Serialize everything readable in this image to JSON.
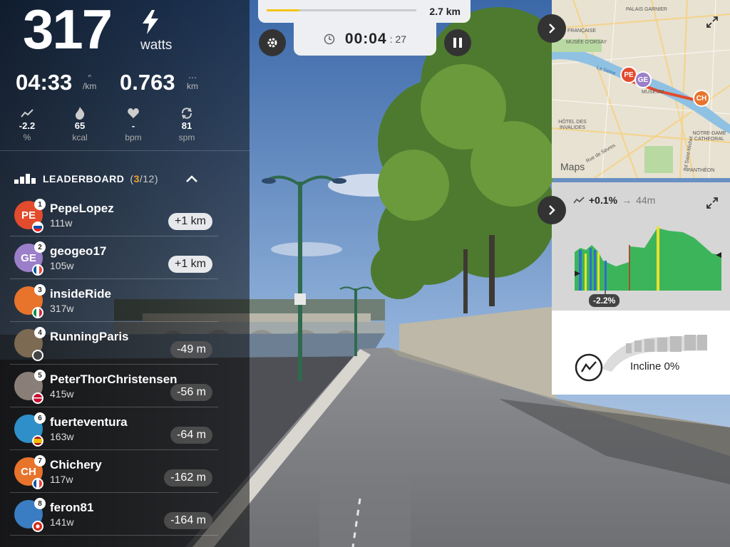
{
  "metrics": {
    "power": "317",
    "power_unit": "watts",
    "pace": "04:33",
    "pace_unit": "/km",
    "distance": "0.763",
    "distance_unit": "km",
    "stats": [
      {
        "icon": "incline-icon",
        "value": "-2.2",
        "unit": "%"
      },
      {
        "icon": "flame-icon",
        "value": "65",
        "unit": "kcal"
      },
      {
        "icon": "heart-icon",
        "value": "-",
        "unit": "bpm"
      },
      {
        "icon": "cadence-icon",
        "value": "81",
        "unit": "spm"
      }
    ]
  },
  "leaderboard": {
    "title": "LEADERBOARD",
    "position": "3",
    "total": "/12",
    "rows": [
      {
        "rank": "1",
        "initials": "PE",
        "avatar_color": "#e24b2d",
        "flag": "sk",
        "name": "PepeLopez",
        "watts": "111w",
        "gap": "+1 km",
        "gap_style": "light"
      },
      {
        "rank": "2",
        "initials": "GE",
        "avatar_color": "#9b7fc8",
        "flag": "fr",
        "name": "geogeo17",
        "watts": "105w",
        "gap": "+1 km",
        "gap_style": "light"
      },
      {
        "rank": "3",
        "initials": "",
        "avatar_color": "#e8742c",
        "flag": "it",
        "name": "insideRide",
        "watts": "317w",
        "gap": "",
        "gap_style": "none"
      },
      {
        "rank": "4",
        "initials": "",
        "avatar_color": "#7d6a52",
        "flag": "none",
        "name": "RunningParis",
        "watts": "",
        "gap": "-49 m",
        "gap_style": "dark"
      },
      {
        "rank": "5",
        "initials": "",
        "avatar_color": "#8a7f78",
        "flag": "dk",
        "name": "PeterThorChristensen",
        "watts": "415w",
        "gap": "-56 m",
        "gap_style": "dark"
      },
      {
        "rank": "6",
        "initials": "",
        "avatar_color": "#2f8fc9",
        "flag": "es",
        "name": "fuerteventura",
        "watts": "163w",
        "gap": "-64 m",
        "gap_style": "dark"
      },
      {
        "rank": "7",
        "initials": "CH",
        "avatar_color": "#e8742c",
        "flag": "fr",
        "name": "Chichery",
        "watts": "117w",
        "gap": "-162 m",
        "gap_style": "dark"
      },
      {
        "rank": "8",
        "initials": "",
        "avatar_color": "#3a7dc2",
        "flag": "ch",
        "name": "feron81",
        "watts": "141w",
        "gap": "-164 m",
        "gap_style": "dark"
      }
    ]
  },
  "route": {
    "distance": "2.7 km",
    "progress": 0.22
  },
  "timer": {
    "hours": "00",
    "minutes": "04",
    "seconds": "27"
  },
  "map": {
    "attribution": "Maps",
    "labels": [
      "PALAIS GARNIER",
      "MUSÉE D'ORSAY",
      "MUSEUM",
      "HÔTEL DES INVALIDES",
      "NOTRE-DAME CATHEDRAL",
      "PANTHÉON",
      "Rue de Sèvres",
      "Bd Saint-Michel",
      "La Seine",
      "FRANÇAISE"
    ],
    "pins": [
      {
        "initials": "PE",
        "color": "#e24b2d"
      },
      {
        "initials": "GE",
        "color": "#9b7fc8"
      },
      {
        "initials": "CH",
        "color": "#e8742c"
      }
    ]
  },
  "elevation": {
    "grade": "+0.1%",
    "arrow": "→",
    "length": "44m",
    "current_grade": "-2.2%"
  },
  "incline": {
    "label": "Incline 0%",
    "value_percent": 0
  },
  "colors": {
    "accent": "#f5a623",
    "elev_green": "#3cb55a",
    "elev_yellow": "#e9e230",
    "elev_blue": "#2f6fc9"
  }
}
